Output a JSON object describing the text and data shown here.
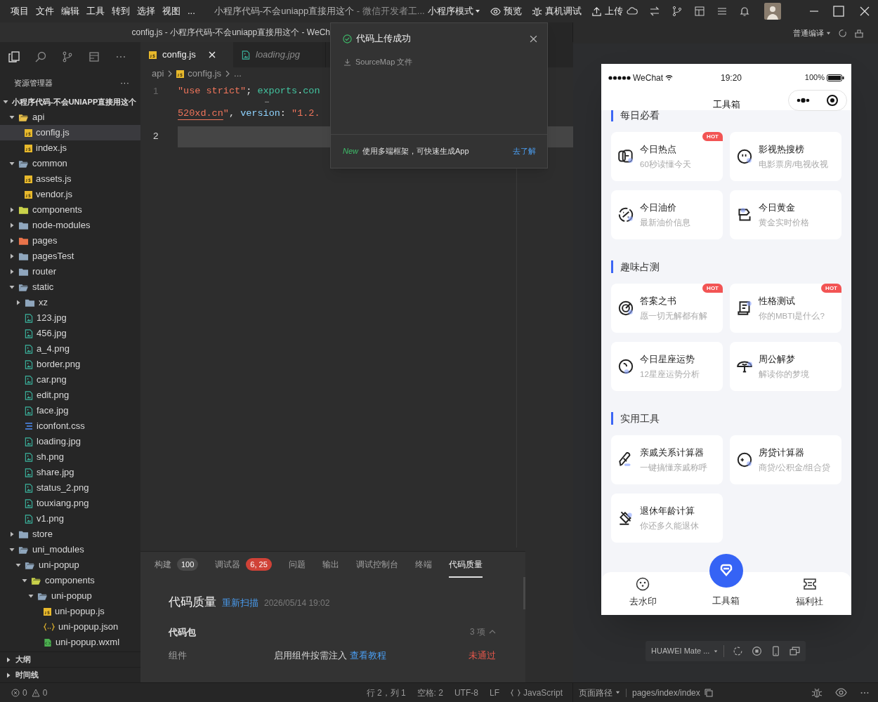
{
  "menu_bar": {
    "menus": [
      "项目",
      "文件",
      "编辑",
      "工具",
      "转到",
      "选择",
      "视图",
      "..."
    ],
    "project_title": "小程序代码-不会uniapp直接用这个",
    "app_title": " - 微信开发者工...",
    "mode": "小程序模式",
    "actions": [
      {
        "kind": "preview",
        "label": "预览"
      },
      {
        "kind": "debug",
        "label": "真机调试"
      },
      {
        "kind": "upload",
        "label": "上传"
      }
    ]
  },
  "window_subtitle": "config.js - 小程序代码-不会uniapp直接用这个 - WeCh",
  "explorer": {
    "title": "资源管理器",
    "more": "···",
    "tree": [
      {
        "label": "小程序代码-不会UNIAPP直接用这个",
        "kind": "root",
        "expanded": true,
        "selected": false,
        "children": [
          {
            "label": "api",
            "kind": "folder",
            "color": "#e8c04a",
            "expanded": true,
            "selected": false,
            "children": [
              {
                "label": "config.js",
                "kind": "js",
                "selected": true
              },
              {
                "label": "index.js",
                "kind": "js",
                "selected": false
              }
            ]
          },
          {
            "label": "common",
            "kind": "folder",
            "expanded": true,
            "selected": false,
            "children": [
              {
                "label": "assets.js",
                "kind": "js",
                "selected": false
              },
              {
                "label": "vendor.js",
                "kind": "js",
                "selected": false
              }
            ]
          },
          {
            "label": "components",
            "kind": "folder",
            "color": "#c9d24a",
            "expanded": false,
            "selected": false
          },
          {
            "label": "node-modules",
            "kind": "folder",
            "expanded": false,
            "selected": false
          },
          {
            "label": "pages",
            "kind": "folder",
            "color": "#e8734a",
            "expanded": false,
            "selected": false
          },
          {
            "label": "pagesTest",
            "kind": "folder",
            "expanded": false,
            "selected": false
          },
          {
            "label": "router",
            "kind": "folder",
            "expanded": false,
            "selected": false
          },
          {
            "label": "static",
            "kind": "folder",
            "expanded": true,
            "selected": false,
            "children": [
              {
                "label": "xz",
                "kind": "folder",
                "expanded": false,
                "selected": false
              },
              {
                "label": "123.jpg",
                "kind": "image",
                "selected": false
              },
              {
                "label": "456.jpg",
                "kind": "image",
                "selected": false
              },
              {
                "label": "a_4.png",
                "kind": "image",
                "selected": false
              },
              {
                "label": "border.png",
                "kind": "image",
                "selected": false
              },
              {
                "label": "car.png",
                "kind": "image",
                "selected": false
              },
              {
                "label": "edit.png",
                "kind": "image",
                "selected": false
              },
              {
                "label": "face.jpg",
                "kind": "image",
                "selected": false
              },
              {
                "label": "iconfont.css",
                "kind": "css",
                "selected": false
              },
              {
                "label": "loading.jpg",
                "kind": "image",
                "selected": false
              },
              {
                "label": "sh.png",
                "kind": "image",
                "selected": false
              },
              {
                "label": "share.jpg",
                "kind": "image",
                "selected": false
              },
              {
                "label": "status_2.png",
                "kind": "image",
                "selected": false
              },
              {
                "label": "touxiang.png",
                "kind": "image",
                "selected": false
              },
              {
                "label": "v1.png",
                "kind": "image",
                "selected": false
              }
            ]
          },
          {
            "label": "store",
            "kind": "folder",
            "expanded": false,
            "selected": false
          },
          {
            "label": "uni_modules",
            "kind": "folder",
            "expanded": true,
            "selected": false,
            "children": [
              {
                "label": "uni-popup",
                "kind": "folder",
                "expanded": true,
                "selected": false,
                "children": [
                  {
                    "label": "components",
                    "kind": "folder",
                    "color": "#c9d24a",
                    "expanded": true,
                    "selected": false,
                    "children": [
                      {
                        "label": "uni-popup",
                        "kind": "folder",
                        "expanded": true,
                        "selected": false,
                        "children": [
                          {
                            "label": "uni-popup.js",
                            "kind": "js",
                            "selected": false
                          },
                          {
                            "label": "uni-popup.json",
                            "kind": "json",
                            "selected": false
                          },
                          {
                            "label": "uni-popup.wxml",
                            "kind": "wxml",
                            "selected": false
                          }
                        ]
                      }
                    ]
                  }
                ]
              }
            ]
          }
        ]
      }
    ]
  },
  "outline": [
    {
      "label": "大纲",
      "expanded": false
    },
    {
      "label": "时间线",
      "expanded": false
    }
  ],
  "editor": {
    "tabs": [
      {
        "label": "config.js",
        "kind": "js",
        "selected": true
      },
      {
        "label": "loading.jpg",
        "kind": "image",
        "selected": false
      }
    ],
    "breadcrumb": [
      {
        "label": "api",
        "kind": "folder"
      },
      {
        "label": "config.js",
        "kind": "js"
      },
      {
        "label": "...",
        "kind": "more"
      }
    ],
    "lines": [
      {
        "number": "1",
        "current": false,
        "fold_marker": "…",
        "rows": [
          {
            "tokens": [
              {
                "text": "\"use strict\"",
                "kind": "string",
                "squiggle": false
              },
              {
                "text": "; ",
                "kind": "punct",
                "squiggle": false
              },
              {
                "text": "exports",
                "kind": "ident",
                "squiggle": false
              },
              {
                "text": ".",
                "kind": "punct",
                "squiggle": false
              },
              {
                "text": "con",
                "kind": "ident",
                "squiggle": false
              }
            ]
          },
          {
            "tokens": [
              {
                "text": "520xd.cn",
                "kind": "string",
                "squiggle": true
              },
              {
                "text": "\"",
                "kind": "string",
                "squiggle": false
              },
              {
                "text": ", ",
                "kind": "punct",
                "squiggle": false
              },
              {
                "text": "version",
                "kind": "property",
                "squiggle": false
              },
              {
                "text": ": ",
                "kind": "punct",
                "squiggle": false
              },
              {
                "text": "\"1.2.",
                "kind": "string",
                "squiggle": false
              }
            ]
          }
        ]
      },
      {
        "number": "2",
        "current": true
      }
    ]
  },
  "popup": {
    "title": "代码上传成功",
    "file_label": "SourceMap 文件",
    "badge": "New",
    "message": "使用多端框架，可快速生成App",
    "link": "去了解"
  },
  "panel": {
    "tabs": [
      {
        "label": "构建",
        "badge": "100",
        "color": "#4a4a4a",
        "selected": false
      },
      {
        "label": "调试器",
        "badge": "6, 25",
        "color": "#d04237",
        "selected": false
      },
      {
        "label": "问题",
        "selected": false
      },
      {
        "label": "输出",
        "selected": false
      },
      {
        "label": "调试控制台",
        "selected": false
      },
      {
        "label": "终端",
        "selected": false
      },
      {
        "label": "代码质量",
        "selected": true
      }
    ],
    "quality": {
      "title": "代码质量",
      "rescan": "重新扫描",
      "time": "2026/05/14 19:02",
      "group": {
        "title": "代码包",
        "count": "3 项",
        "expanded": true
      },
      "rows": [
        {
          "name": "组件",
          "description": "启用组件按需注入",
          "link": "查看教程",
          "result": "未通过",
          "passed": false
        }
      ]
    }
  },
  "status_bar": {
    "errors": "0",
    "warnings": "0",
    "items": [
      "行 2，列 1",
      "空格: 2",
      "UTF-8",
      "LF"
    ],
    "language": "JavaScript"
  },
  "simulator": {
    "compile_mode": "普通编译",
    "phone": {
      "carrier": "WeChat",
      "time": "19:20",
      "battery": "100%",
      "title": "工具箱",
      "sections": [
        {
          "title": "每日必看",
          "cards": [
            {
              "title": "今日热点",
              "subtitle": "60秒读懂今天",
              "badge": "HOT"
            },
            {
              "title": "影视热搜榜",
              "subtitle": "电影票房/电视收视"
            },
            {
              "title": "今日油价",
              "subtitle": "最新油价信息"
            },
            {
              "title": "今日黄金",
              "subtitle": "黄金实时价格"
            }
          ]
        },
        {
          "title": "趣味占测",
          "cards": [
            {
              "title": "答案之书",
              "subtitle": "愿一切无解都有解",
              "badge": "HOT"
            },
            {
              "title": "性格测试",
              "subtitle": "你的MBTI是什么?",
              "badge": "HOT"
            },
            {
              "title": "今日星座运势",
              "subtitle": "12星座运势分析"
            },
            {
              "title": "周公解梦",
              "subtitle": "解读你的梦境"
            }
          ]
        },
        {
          "title": "实用工具",
          "cards": [
            {
              "title": "亲戚关系计算器",
              "subtitle": "一键搞懂亲戚称呼"
            },
            {
              "title": "房贷计算器",
              "subtitle": "商贷/公积金/组合贷"
            },
            {
              "title": "退休年龄计算",
              "subtitle": "你还多久能退休"
            }
          ]
        }
      ],
      "tabbar": [
        {
          "label": "去水印",
          "kind": "normal"
        },
        {
          "label": "工具箱",
          "kind": "center"
        },
        {
          "label": "福利社",
          "kind": "normal"
        }
      ]
    },
    "device": "HUAWEI Mate ...",
    "page_path_label": "页面路径",
    "page_path": "pages/index/index"
  }
}
